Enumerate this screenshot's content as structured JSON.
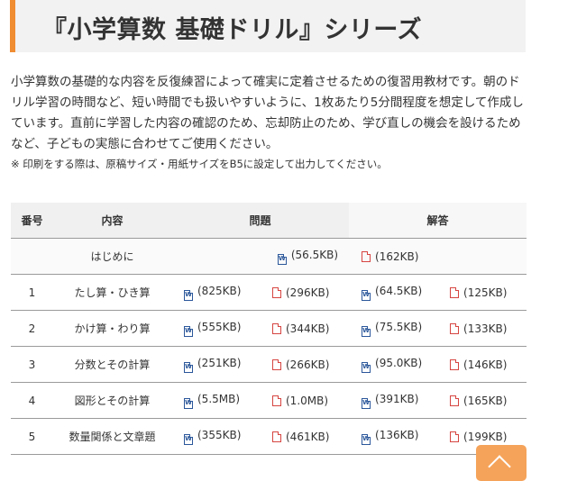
{
  "page": {
    "title": "『小学算数 基礎ドリル』シリーズ",
    "intro": "小学算数の基礎的な内容を反復練習によって確実に定着させるための復習用教材です。朝のドリル学習の時間など、短い時間でも扱いやすいように、1枚あたり5分間程度を想定して作成しています。直前に学習した内容の確認のため、忘却防止のため、学び直しの機会を設けるためなど、子どもの実態に合わせてご使用ください。",
    "note": "※ 印刷をする際は、原稿サイズ・用紙サイズをB5に設定して出力してください。"
  },
  "table": {
    "headers": {
      "number": "番号",
      "content": "内容",
      "questions": "問題",
      "answers": "解答"
    },
    "intro_row": {
      "content": "はじめに",
      "word_size": "(56.5KB)",
      "pdf_size": "(162KB)"
    },
    "rows": [
      {
        "number": "1",
        "content": "たし算・ひき算",
        "q_word": "(825KB)",
        "q_pdf": "(296KB)",
        "a_word": "(64.5KB)",
        "a_pdf": "(125KB)"
      },
      {
        "number": "2",
        "content": "かけ算・わり算",
        "q_word": "(555KB)",
        "q_pdf": "(344KB)",
        "a_word": "(75.5KB)",
        "a_pdf": "(133KB)"
      },
      {
        "number": "3",
        "content": "分数とその計算",
        "q_word": "(251KB)",
        "q_pdf": "(266KB)",
        "a_word": "(95.0KB)",
        "a_pdf": "(146KB)"
      },
      {
        "number": "4",
        "content": "図形とその計算",
        "q_word": "(5.5MB)",
        "q_pdf": "(1.0MB)",
        "a_word": "(391KB)",
        "a_pdf": "(165KB)"
      },
      {
        "number": "5",
        "content": "数量関係と文章題",
        "q_word": "(355KB)",
        "q_pdf": "(461KB)",
        "a_word": "(136KB)",
        "a_pdf": "(199KB)"
      }
    ]
  },
  "icons": {
    "word": "word-file-icon",
    "pdf": "pdf-file-icon",
    "to_top": "chevron-up-icon"
  },
  "colors": {
    "accent": "#f08c32",
    "word": "#2b579a",
    "pdf": "#d64541",
    "to_top": "#f5a35a"
  }
}
